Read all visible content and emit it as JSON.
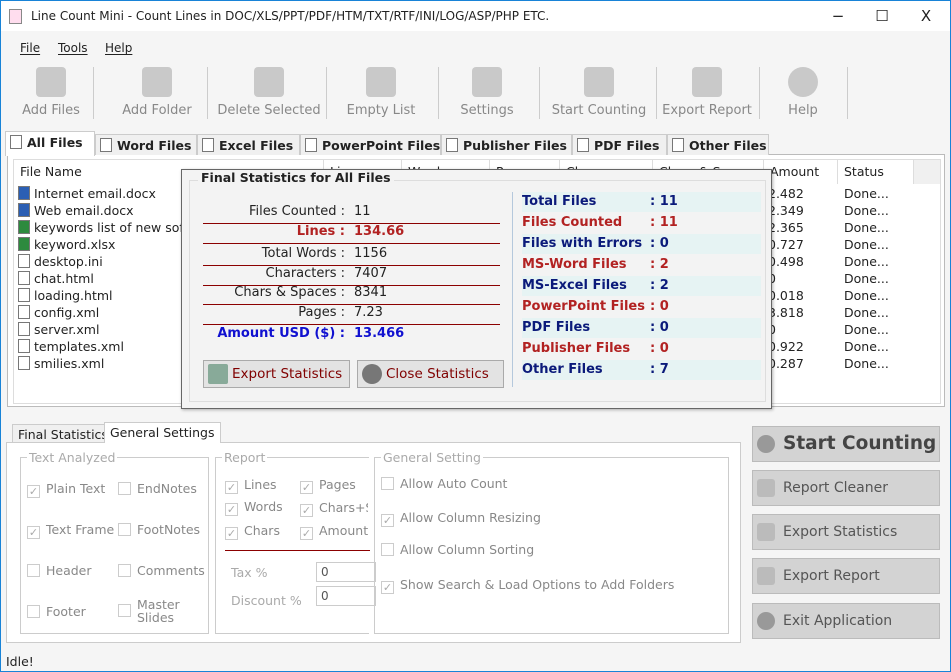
{
  "window": {
    "title": "Line Count Mini - Count Lines in DOC/XLS/PPT/PDF/HTM/TXT/RTF/INI/LOG/ASP/PHP ETC.",
    "minimize": "−",
    "maximize": "☐",
    "close": "X"
  },
  "menu": [
    "File",
    "Tools",
    "Help"
  ],
  "toolbar": [
    {
      "label": "Add Files",
      "icon": "add-files-icon"
    },
    {
      "label": "Add Folder",
      "icon": "add-folder-icon"
    },
    {
      "label": "Delete Selected",
      "icon": "delete-icon"
    },
    {
      "label": "Empty List",
      "icon": "trash-icon"
    },
    {
      "label": "Settings",
      "icon": "wrench-icon"
    },
    {
      "label": "Start Counting",
      "icon": "gear-icon"
    },
    {
      "label": "Export Report",
      "icon": "export-icon"
    },
    {
      "label": "Help",
      "icon": "help-icon"
    }
  ],
  "tabs": [
    "All Files",
    "Word Files",
    "Excel Files",
    "PowerPoint Files",
    "Publisher Files",
    "PDF Files",
    "Other Files"
  ],
  "columns": [
    "File Name",
    "Lines",
    "Words",
    "Pages",
    "Chars",
    "Chars & Spaces",
    "Amount",
    "Status"
  ],
  "files": [
    {
      "name": "Internet email.docx",
      "type": "word",
      "amount": "2.482",
      "status": "Done..."
    },
    {
      "name": "Web email.docx",
      "type": "word",
      "amount": "2.349",
      "status": "Done..."
    },
    {
      "name": "keywords list of new software.xlsx",
      "type": "excel",
      "amount": "2.365",
      "status": "Done..."
    },
    {
      "name": "keyword.xlsx",
      "type": "excel",
      "amount": "0.727",
      "status": "Done..."
    },
    {
      "name": "desktop.ini",
      "type": "text",
      "amount": "0.498",
      "status": "Done..."
    },
    {
      "name": "chat.html",
      "type": "text",
      "amount": "0",
      "status": "Done..."
    },
    {
      "name": "loading.html",
      "type": "text",
      "amount": "0.018",
      "status": "Done..."
    },
    {
      "name": "config.xml",
      "type": "text",
      "amount": "3.818",
      "status": "Done..."
    },
    {
      "name": "server.xml",
      "type": "text",
      "amount": "0",
      "status": "Done..."
    },
    {
      "name": "templates.xml",
      "type": "text",
      "amount": "0.922",
      "status": "Done..."
    },
    {
      "name": "smilies.xml",
      "type": "text",
      "amount": "0.287",
      "status": "Done..."
    }
  ],
  "stats": {
    "title": "Final Statistics for All Files",
    "left": [
      {
        "k": "Files Counted :",
        "v": "11"
      },
      {
        "k": "Lines :",
        "v": "134.66"
      },
      {
        "k": "Total Words :",
        "v": "1156"
      },
      {
        "k": "Characters :",
        "v": "7407"
      },
      {
        "k": "Chars & Spaces :",
        "v": "8341"
      },
      {
        "k": "Pages :",
        "v": "7.23"
      },
      {
        "k": "Amount USD ($) :",
        "v": "13.466"
      }
    ],
    "right": [
      {
        "k": "Total Files",
        "v": ": 11"
      },
      {
        "k": "Files Counted",
        "v": ": 11"
      },
      {
        "k": "Files with Errors",
        "v": ": 0"
      },
      {
        "k": "MS-Word Files",
        "v": ": 2"
      },
      {
        "k": "MS-Excel Files",
        "v": ": 2"
      },
      {
        "k": "PowerPoint Files",
        "v": ": 0"
      },
      {
        "k": "PDF Files",
        "v": ": 0"
      },
      {
        "k": "Publisher Files",
        "v": ": 0"
      },
      {
        "k": "Other Files",
        "v": ": 7"
      }
    ],
    "export": "Export Statistics",
    "close": "Close Statistics"
  },
  "bottom_tabs": [
    "Final Statistics",
    "General Settings"
  ],
  "text_analyzed": {
    "title": "Text Analyzed",
    "items": [
      {
        "l": "Plain Text",
        "c": true
      },
      {
        "l": "EndNotes",
        "c": false
      },
      {
        "l": "Text Frame",
        "c": true
      },
      {
        "l": "FootNotes",
        "c": false
      },
      {
        "l": "Header",
        "c": false
      },
      {
        "l": "Comments",
        "c": false
      },
      {
        "l": "Footer",
        "c": false
      },
      {
        "l": "Master Slides",
        "c": false
      }
    ]
  },
  "report": {
    "title": "Report",
    "items": [
      {
        "l": "Lines",
        "c": true
      },
      {
        "l": "Pages",
        "c": true
      },
      {
        "l": "Words",
        "c": true
      },
      {
        "l": "Chars+Spaces",
        "c": true
      },
      {
        "l": "Chars",
        "c": true
      },
      {
        "l": "Amount",
        "c": true
      }
    ],
    "tax_label": "Tax %",
    "tax": "0",
    "discount_label": "Discount %",
    "discount": "0"
  },
  "general": {
    "title": "General Setting",
    "items": [
      {
        "l": "Allow Auto Count",
        "c": false
      },
      {
        "l": "Allow Column Resizing",
        "c": true
      },
      {
        "l": "Allow Column Sorting",
        "c": false
      },
      {
        "l": "Show Search & Load Options to Add Folders",
        "c": true
      }
    ]
  },
  "actions": [
    "Start Counting",
    "Report Cleaner",
    "Export Statistics",
    "Export Report",
    "Exit Application"
  ],
  "status": "Idle!",
  "colors": {
    "accent": "#1883d7",
    "stat_red": "#b22222",
    "stat_navy": "#0b1a7a",
    "amount_blue": "#1010d0"
  }
}
